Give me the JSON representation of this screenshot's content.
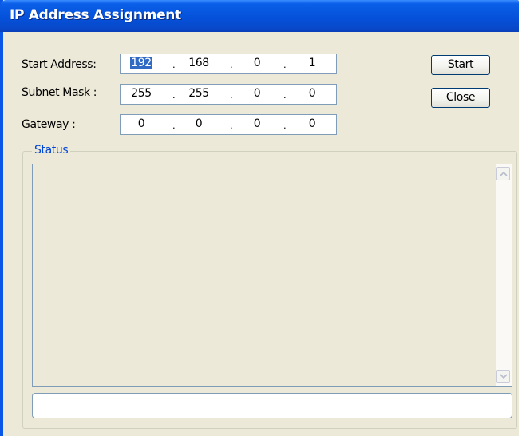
{
  "window": {
    "title": "IP Address Assignment"
  },
  "form": {
    "start_label": "Start Address:",
    "start": [
      "192",
      "168",
      "0",
      "1"
    ],
    "subnet_label": "Subnet Mask :",
    "subnet": [
      "255",
      "255",
      "0",
      "0"
    ],
    "gateway_label": "Gateway :",
    "gateway": [
      "0",
      "0",
      "0",
      "0"
    ],
    "separator": "."
  },
  "buttons": {
    "start": "Start",
    "close": "Close"
  },
  "status": {
    "label": "Status"
  },
  "icons": {
    "scroll_up": "chevron-up-icon",
    "scroll_down": "chevron-down-icon"
  },
  "colors": {
    "titlebar": "#0550D8",
    "selection": "#316AC5",
    "group_label": "#0046D5"
  }
}
